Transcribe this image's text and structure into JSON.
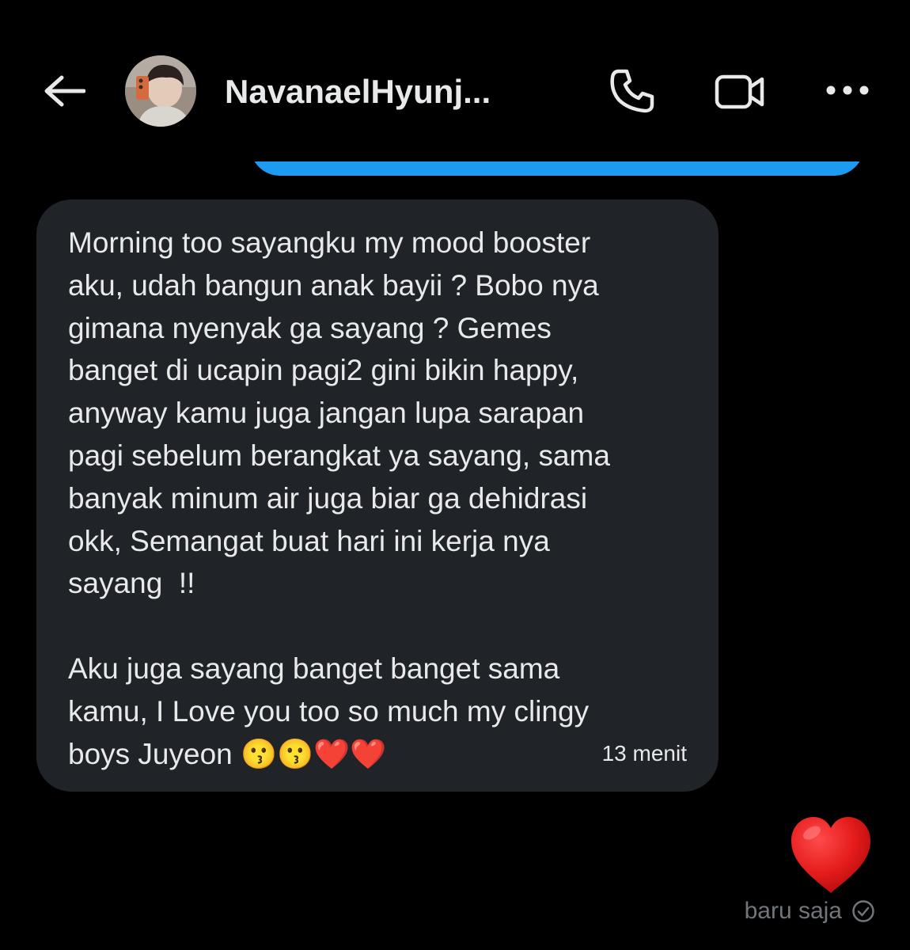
{
  "header": {
    "back_icon": "arrow-left-icon",
    "contact_name": "NavanaelHyunj...",
    "call_icon": "phone-icon",
    "video_icon": "video-camera-icon",
    "more_icon": "more-horizontal-icon"
  },
  "sent_bubble": {
    "color": "#1d9bf0"
  },
  "received_message": {
    "text": "Morning too sayangku my mood booster\naku, udah bangun anak bayii ? Bobo nya\ngimana nyenyak ga sayang ? Gemes\nbanget di ucapin pagi2 gini bikin happy,\nanyway kamu juga jangan lupa sarapan\npagi sebelum berangkat ya sayang, sama\nbanyak minum air juga biar ga dehidrasi\nokk, Semangat buat hari ini kerja nya\nsayang  !!\n\nAku juga sayang banget banget sama\nkamu, I Love you too so much my clingy\nboys Juyeon 😗😗❤️❤️",
    "time": "13 menit",
    "bubble_color": "#202327"
  },
  "sent_reaction": {
    "emoji": "❤️",
    "time": "baru saja",
    "status_icon": "check-circle-icon"
  }
}
